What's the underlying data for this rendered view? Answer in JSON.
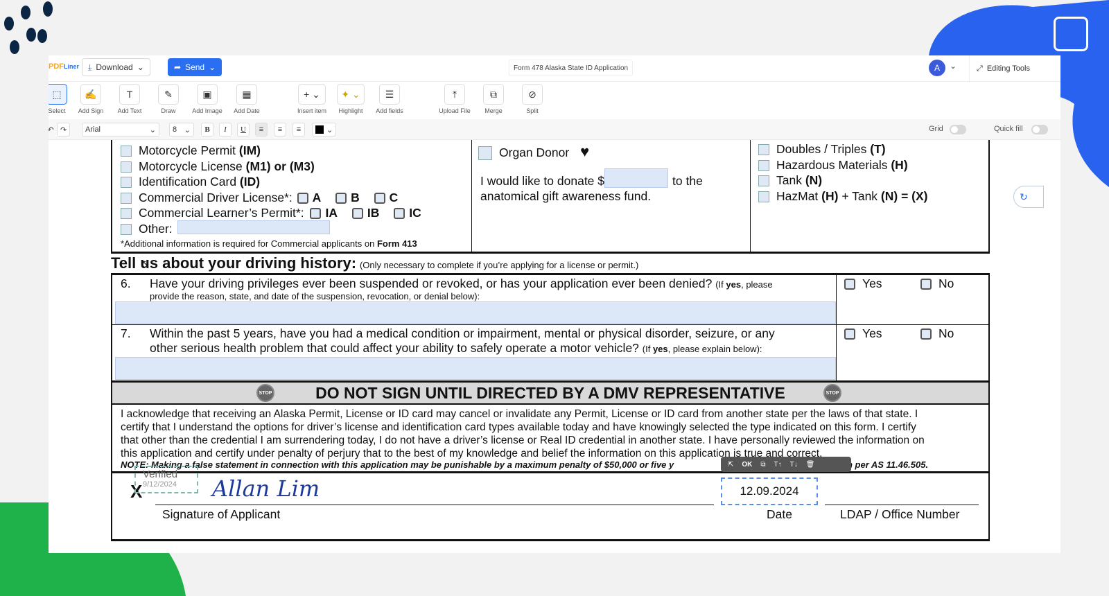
{
  "app": {
    "logo": "PDFLiner",
    "download_label": "Download",
    "send_label": "Send",
    "doc_title": "Form 478 Alaska State ID Application",
    "avatar_letter": "A",
    "editing_tools_label": "Editing Tools"
  },
  "toolbar": [
    {
      "label": "Select",
      "icon": "select-icon"
    },
    {
      "label": "Add Sign",
      "icon": "sign-icon"
    },
    {
      "label": "Add Text",
      "icon": "text-icon"
    },
    {
      "label": "Draw",
      "icon": "draw-icon"
    },
    {
      "label": "Add Image",
      "icon": "image-icon"
    },
    {
      "label": "Add Date",
      "icon": "calendar-icon"
    },
    {
      "label": "Insert item",
      "icon": "plus-icon"
    },
    {
      "label": "Highlight",
      "icon": "highlight-icon"
    },
    {
      "label": "Add fields",
      "icon": "fields-icon"
    },
    {
      "label": "Upload File",
      "icon": "upload-icon"
    },
    {
      "label": "Merge",
      "icon": "merge-icon"
    },
    {
      "label": "Split",
      "icon": "split-icon"
    }
  ],
  "format": {
    "font": "Arial",
    "size": "8",
    "bold": "B",
    "italic": "I",
    "underline": "U",
    "grid_label": "Grid",
    "quickfill_label": "Quick fill",
    "text_color": "#000000"
  },
  "doc": {
    "left_options": [
      {
        "text": "Motorcycle Permit ",
        "bold": "(IM)"
      },
      {
        "text": "Motorcycle License ",
        "bold": "(M1) or (M3)"
      },
      {
        "text": "Identification Card ",
        "bold": "(ID)"
      }
    ],
    "cdl_label": "Commercial Driver License*:",
    "cdl_classes": [
      "A",
      "B",
      "C"
    ],
    "clp_label": "Commercial Learner’s Permit*:",
    "clp_classes": [
      "IA",
      "IB",
      "IC"
    ],
    "other_label": "Other:",
    "footnote_prefix": "*",
    "footnote": "Additional information is required for Commercial applicants on ",
    "footnote_form": "Form 413",
    "organ_donor": "Organ Donor",
    "donate_prefix": "I would like to donate $",
    "donate_suffix": "to the",
    "donate_line2": "anatomical gift awareness fund.",
    "endorsements": [
      {
        "text": "Doubles / Triples ",
        "bold": "(T)"
      },
      {
        "text": "Hazardous Materials ",
        "bold": "(H)"
      },
      {
        "text": "Tank ",
        "bold": "(N)"
      },
      {
        "text": "HazMat ",
        "bold": "(H)",
        "mid": " + Tank ",
        "bold2": "(N)",
        "end": " = (X)"
      }
    ],
    "history_title": "Tell us about your driving history:",
    "history_note": "(Only necessary to complete if you’re applying for a license or permit.)",
    "q6_num": "6.",
    "q6_text": "Have your driving privileges ever been suspended or revoked, or has your application ever been denied?",
    "q6_note_a": "(If ",
    "q6_note_yes": "yes",
    "q6_note_b": ", please",
    "q6_line2": "provide the reason, state, and date of the suspension, revocation, or denial below):",
    "q7_num": "7.",
    "q7_text": "Within the past 5 years, have you had a medical condition or impairment, mental or physical disorder, seizure, or any",
    "q7_line2": "other serious health problem that could affect your ability to safely operate a motor vehicle?",
    "q7_note_a": "(If ",
    "q7_note_yes": "yes",
    "q7_note_b": ", please explain below):",
    "yes_label": "Yes",
    "no_label": "No",
    "dmv_banner": "DO NOT SIGN UNTIL DIRECTED BY A DMV REPRESENTATIVE",
    "stop_label": "STOP",
    "ack_lines": [
      "I acknowledge that receiving an Alaska Permit, License or ID card may cancel or invalidate any Permit, License or ID card from another state per the laws of that state. I",
      "certify that I understand the options for driver’s license and identification card types available today and have knowingly selected the type indicated on this form. I certify",
      "that other than the credential I am surrendering today, I do not have a driver’s license or Real ID credential in another state.  I have personally reviewed the information on",
      "this application and certify under penalty of perjury that to the best of my knowledge and belief the information on this application is true and correct."
    ],
    "note_line": "NOTE: Making a false statement in connection with this application may be punishable by a maximum penalty of $50,000 or five y",
    "note_tail": "n per AS 11.46.505.",
    "sign_x": "X",
    "verified_label": "Verified",
    "verified_date": "9/12/2024",
    "signature": "Allan Lim",
    "signature_label": "Signature of Applicant",
    "date_value": "12.09.2024",
    "date_label": "Date",
    "ldap_label": "LDAP / Office Number",
    "mini_toolbar": {
      "ok": "OK"
    }
  }
}
